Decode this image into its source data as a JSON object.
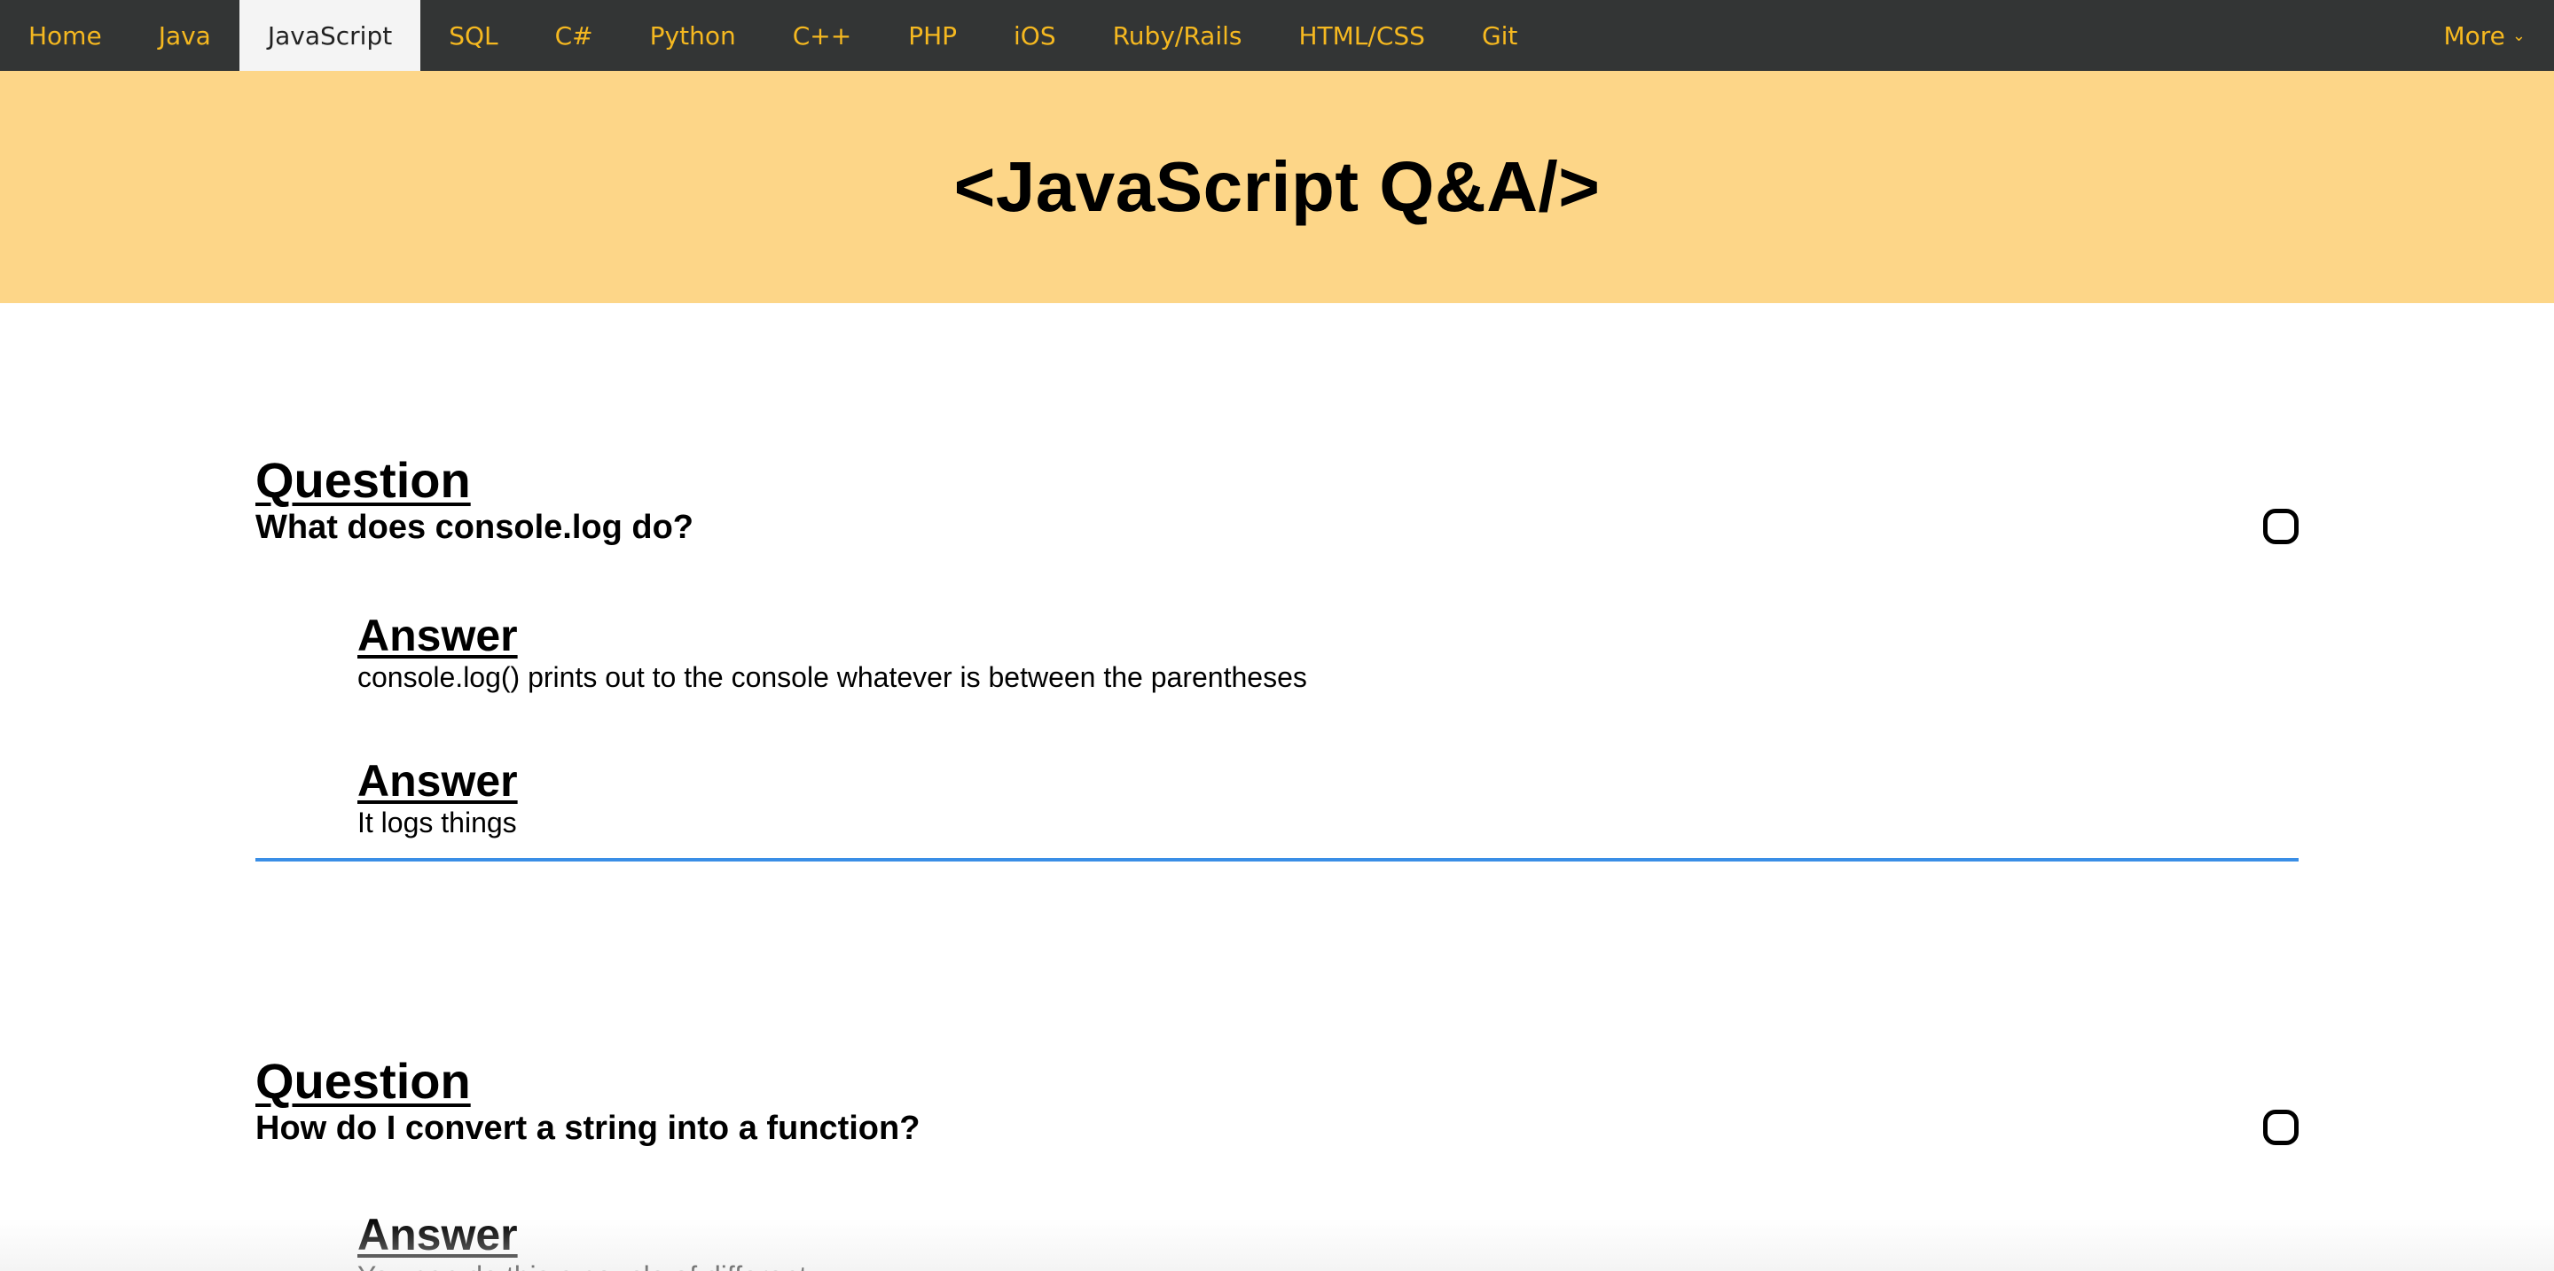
{
  "nav": {
    "items": [
      {
        "label": "Home",
        "active": false
      },
      {
        "label": "Java",
        "active": false
      },
      {
        "label": "JavaScript",
        "active": true
      },
      {
        "label": "SQL",
        "active": false
      },
      {
        "label": "C#",
        "active": false
      },
      {
        "label": "Python",
        "active": false
      },
      {
        "label": "C++",
        "active": false
      },
      {
        "label": "PHP",
        "active": false
      },
      {
        "label": "iOS",
        "active": false
      },
      {
        "label": "Ruby/Rails",
        "active": false
      },
      {
        "label": "HTML/CSS",
        "active": false
      },
      {
        "label": "Git",
        "active": false
      }
    ],
    "more_label": "More",
    "more_caret": "⌄"
  },
  "hero": {
    "title": "<JavaScript Q&A/>"
  },
  "questions": [
    {
      "heading": "Question",
      "text": "What does console.log do?",
      "answers": [
        {
          "heading": "Answer",
          "text": "console.log() prints out to the console whatever is between the parentheses"
        },
        {
          "heading": "Answer",
          "text": "It logs things"
        }
      ]
    },
    {
      "heading": "Question",
      "text": "How do I convert a string into a function?",
      "answers": [
        {
          "heading": "Answer",
          "text": "You can do this a couple of different..."
        }
      ]
    }
  ],
  "colors": {
    "nav_bg": "#333535",
    "nav_text": "#f5b820",
    "nav_active_bg": "#f4f4f4",
    "hero_bg": "#fdd688",
    "divider": "#3a8ee6"
  }
}
